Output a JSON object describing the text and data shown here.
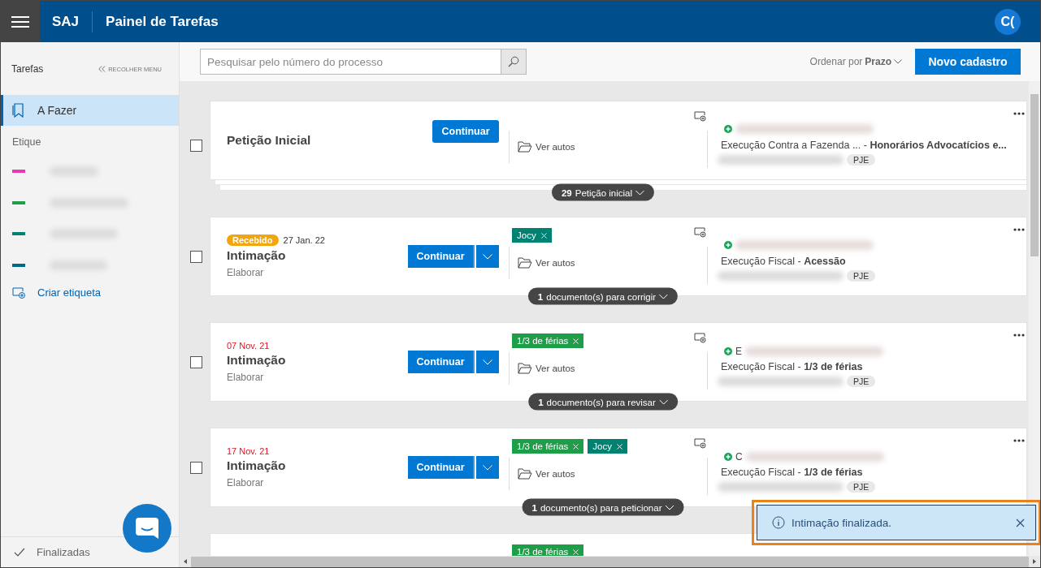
{
  "header": {
    "app": "SAJ",
    "title": "Painel de Tarefas",
    "avatar": "C("
  },
  "sidebar": {
    "title": "Tarefas",
    "collapse": "RECOLHER MENU",
    "items": [
      {
        "label": "A Fazer",
        "selected": true
      }
    ],
    "labels_heading": "Etique",
    "labels": [
      {
        "color": "#e83ab4"
      },
      {
        "color": "#1e9e48"
      },
      {
        "color": "#008272"
      },
      {
        "color": "#006a80"
      }
    ],
    "create_label": "Criar etiqueta",
    "footer": "Finalizadas"
  },
  "toolbar": {
    "search": {
      "placeholder": "Pesquisar pelo número do processo"
    },
    "sort_label": "Ordenar por",
    "sort_value": "Prazo",
    "new_button": "Novo cadastro"
  },
  "cards": [
    {
      "kind": "task",
      "checked": false,
      "stacked": true,
      "title": "Petição Inicial",
      "split": false,
      "button": "Continuar",
      "link": "Ver autos",
      "process": "Execução Contra a Fazenda ...   - **Honorários Advocatícios e...**",
      "system": "PJE",
      "pill": "**29** Petição inicial"
    },
    {
      "kind": "task",
      "checked": false,
      "stacked": false,
      "badge": "Recebido",
      "date": "27 Jan. 22",
      "overdue": false,
      "title": "Intimação",
      "subtitle": "Elaborar",
      "split": true,
      "button": "Continuar",
      "tags": [
        {
          "label": "Jocy",
          "color": "#008272"
        }
      ],
      "link": "Ver autos",
      "process": "Execução Fiscal - **Acessão**",
      "system": "PJE",
      "pill": "**1** documento(s) para corrigir"
    },
    {
      "kind": "task",
      "checked": false,
      "stacked": false,
      "date": "07 Nov. 21",
      "overdue": true,
      "title": "Intimação",
      "subtitle": "Elaborar",
      "split": true,
      "button": "Continuar",
      "tags": [
        {
          "label": "1/3 de férias",
          "color": "#1e9e48"
        }
      ],
      "link": "Ver autos",
      "lead": "E",
      "process": "Execução Fiscal - **1/3 de férias**",
      "system": "PJE",
      "pill": "**1** documento(s) para revisar"
    },
    {
      "kind": "task",
      "checked": false,
      "stacked": false,
      "date": "17 Nov. 21",
      "overdue": true,
      "title": "Intimação",
      "subtitle": "Elaborar",
      "split": true,
      "button": "Continuar",
      "tags": [
        {
          "label": "1/3 de férias",
          "color": "#1e9e48"
        },
        {
          "label": "Jocy",
          "color": "#008272"
        }
      ],
      "link": "Ver autos",
      "lead": "C",
      "process": "Execução Fiscal - **1/3 de férias**",
      "system": "PJE",
      "pill": "**1** documento(s) para peticionar"
    },
    {
      "kind": "partial",
      "tags": [
        {
          "label": "1/3 de férias",
          "color": "#1e9e48"
        }
      ]
    }
  ],
  "toast": {
    "message": "Intimação finalizada."
  }
}
